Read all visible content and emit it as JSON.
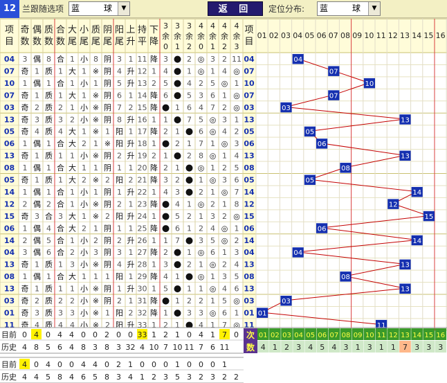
{
  "topbar": {
    "issue_count": "12",
    "follow_label": "兰跟随选项",
    "follow_select": "蓝",
    "follow_select2": "球",
    "back_button": "返 回",
    "dist_label": "定位分布:",
    "dist_select": "蓝",
    "dist_select2": "球"
  },
  "headers": [
    "项目",
    "奇数",
    "偶数",
    "质数",
    "合数",
    "大尾",
    "小尾",
    "质尾",
    "阴尾",
    "阳尾",
    "上升",
    "持平",
    "下降",
    "3余0",
    "3余1",
    "3余2",
    "4余0",
    "4余1",
    "4余2",
    "4余3"
  ],
  "dist_headers": [
    "01",
    "02",
    "03",
    "04",
    "05",
    "06",
    "07",
    "08",
    "09",
    "10",
    "11",
    "12",
    "13",
    "14",
    "15",
    "16"
  ],
  "rows": [
    [
      "04",
      "3",
      "偶",
      "8",
      "合",
      "1",
      "小",
      "8",
      "阴",
      "3",
      "1",
      "11",
      "降",
      "3",
      "●",
      "2",
      "◎",
      "3",
      "2",
      "11"
    ],
    [
      "07",
      "奇",
      "1",
      "质",
      "1",
      "大",
      "1",
      "※",
      "阴",
      "4",
      "升",
      "12",
      "1",
      "4",
      "●",
      "1",
      "◎",
      "1",
      "4",
      "◎"
    ],
    [
      "10",
      "1",
      "偶",
      "1",
      "合",
      "1",
      "小",
      "1",
      "阴",
      "5",
      "升",
      "13",
      "2",
      "5",
      "●",
      "4",
      "2",
      "5",
      "◎",
      "1"
    ],
    [
      "07",
      "奇",
      "1",
      "质",
      "1",
      "大",
      "1",
      "※",
      "阴",
      "6",
      "1",
      "14",
      "降",
      "6",
      "●",
      "5",
      "3",
      "6",
      "1",
      "◎"
    ],
    [
      "03",
      "奇",
      "2",
      "质",
      "2",
      "1",
      "小",
      "※",
      "阴",
      "7",
      "2",
      "15",
      "降",
      "●",
      "1",
      "6",
      "4",
      "7",
      "2",
      "◎"
    ],
    [
      "13",
      "奇",
      "3",
      "质",
      "3",
      "2",
      "小",
      "※",
      "阴",
      "8",
      "升",
      "16",
      "1",
      "1",
      "●",
      "7",
      "5",
      "◎",
      "3",
      "1"
    ],
    [
      "05",
      "奇",
      "4",
      "质",
      "4",
      "大",
      "1",
      "※",
      "1",
      "阳",
      "1",
      "17",
      "降",
      "2",
      "1",
      "●",
      "6",
      "◎",
      "4",
      "2"
    ],
    [
      "06",
      "1",
      "偶",
      "1",
      "合",
      "大",
      "2",
      "1",
      "※",
      "阳",
      "升",
      "18",
      "1",
      "●",
      "2",
      "1",
      "7",
      "1",
      "◎",
      "3"
    ],
    [
      "13",
      "奇",
      "1",
      "质",
      "1",
      "1",
      "小",
      "※",
      "阴",
      "2",
      "升",
      "19",
      "2",
      "1",
      "●",
      "2",
      "8",
      "◎",
      "1",
      "4"
    ],
    [
      "08",
      "1",
      "偶",
      "1",
      "合",
      "大",
      "1",
      "1",
      "阴",
      "1",
      "1",
      "20",
      "降",
      "2",
      "1",
      "●",
      "◎",
      "1",
      "2",
      "5"
    ],
    [
      "05",
      "奇",
      "1",
      "质",
      "1",
      "大",
      "2",
      "※",
      "2",
      "阳",
      "2",
      "21",
      "降",
      "3",
      "2",
      "●",
      "1",
      "◎",
      "3",
      "6"
    ],
    [
      "14",
      "1",
      "偶",
      "1",
      "合",
      "1",
      "小",
      "1",
      "阴",
      "1",
      "升",
      "22",
      "1",
      "4",
      "3",
      "●",
      "2",
      "1",
      "◎",
      "7"
    ],
    [
      "12",
      "2",
      "偶",
      "2",
      "合",
      "1",
      "小",
      "※",
      "阴",
      "2",
      "1",
      "23",
      "降",
      "●",
      "4",
      "1",
      "◎",
      "2",
      "1",
      "8"
    ],
    [
      "15",
      "奇",
      "3",
      "合",
      "3",
      "大",
      "1",
      "※",
      "2",
      "阳",
      "升",
      "24",
      "1",
      "●",
      "5",
      "2",
      "1",
      "3",
      "2",
      "◎"
    ],
    [
      "06",
      "1",
      "偶",
      "4",
      "合",
      "大",
      "2",
      "1",
      "阴",
      "1",
      "1",
      "25",
      "降",
      "●",
      "6",
      "1",
      "2",
      "4",
      "◎",
      "1"
    ],
    [
      "14",
      "2",
      "偶",
      "5",
      "合",
      "1",
      "小",
      "2",
      "阴",
      "2",
      "升",
      "26",
      "1",
      "1",
      "7",
      "●",
      "3",
      "5",
      "◎",
      "2"
    ],
    [
      "04",
      "3",
      "偶",
      "6",
      "合",
      "2",
      "小",
      "3",
      "阴",
      "3",
      "1",
      "27",
      "降",
      "2",
      "●",
      "1",
      "◎",
      "6",
      "1",
      "3"
    ],
    [
      "13",
      "奇",
      "1",
      "质",
      "1",
      "3",
      "小",
      "※",
      "阴",
      "4",
      "升",
      "28",
      "1",
      "3",
      "●",
      "2",
      "1",
      "◎",
      "2",
      "4"
    ],
    [
      "08",
      "1",
      "偶",
      "1",
      "合",
      "大",
      "1",
      "1",
      "1",
      "阳",
      "1",
      "29",
      "降",
      "4",
      "1",
      "●",
      "◎",
      "1",
      "3",
      "5"
    ],
    [
      "13",
      "奇",
      "1",
      "质",
      "1",
      "1",
      "小",
      "※",
      "阴",
      "1",
      "升",
      "30",
      "1",
      "5",
      "●",
      "1",
      "1",
      "◎",
      "4",
      "6"
    ],
    [
      "03",
      "奇",
      "2",
      "质",
      "2",
      "2",
      "小",
      "※",
      "阴",
      "2",
      "1",
      "31",
      "降",
      "●",
      "1",
      "2",
      "2",
      "1",
      "5",
      "◎"
    ],
    [
      "01",
      "奇",
      "3",
      "质",
      "3",
      "3",
      "小",
      "※",
      "1",
      "阳",
      "2",
      "32",
      "降",
      "1",
      "●",
      "3",
      "3",
      "◎",
      "6",
      "1"
    ],
    [
      "11",
      "奇",
      "4",
      "质",
      "4",
      "4",
      "小",
      "※",
      "2",
      "阳",
      "升",
      "33",
      "1",
      "2",
      "1",
      "●",
      "4",
      "1",
      "7",
      "◎"
    ]
  ],
  "dist_rows": [
    [
      "",
      "",
      "",
      "04",
      "",
      "",
      "",
      "",
      "",
      "",
      "",
      "",
      "",
      "",
      "",
      ""
    ],
    [
      "",
      "",
      "",
      "",
      "",
      "",
      "07",
      "",
      "",
      "",
      "",
      "",
      "",
      "",
      "",
      ""
    ],
    [
      "",
      "",
      "",
      "",
      "",
      "",
      "",
      "",
      "",
      "10",
      "",
      "",
      "",
      "",
      "",
      ""
    ],
    [
      "",
      "",
      "",
      "",
      "",
      "",
      "07",
      "",
      "",
      "",
      "",
      "",
      "",
      "",
      "",
      ""
    ],
    [
      "",
      "",
      "03",
      "",
      "",
      "",
      "",
      "",
      "",
      "",
      "",
      "",
      "",
      "",
      "",
      ""
    ],
    [
      "",
      "",
      "",
      "",
      "",
      "",
      "",
      "",
      "",
      "",
      "",
      "",
      "13",
      "",
      "",
      ""
    ],
    [
      "",
      "",
      "",
      "",
      "05",
      "",
      "",
      "",
      "",
      "",
      "",
      "",
      "",
      "",
      "",
      ""
    ],
    [
      "",
      "",
      "",
      "",
      "",
      "06",
      "",
      "",
      "",
      "",
      "",
      "",
      "",
      "",
      "",
      ""
    ],
    [
      "",
      "",
      "",
      "",
      "",
      "",
      "",
      "",
      "",
      "",
      "",
      "",
      "13",
      "",
      "",
      ""
    ],
    [
      "",
      "",
      "",
      "",
      "",
      "",
      "",
      "08",
      "",
      "",
      "",
      "",
      "",
      "",
      "",
      ""
    ],
    [
      "",
      "",
      "",
      "",
      "05",
      "",
      "",
      "",
      "",
      "",
      "",
      "",
      "",
      "",
      "",
      ""
    ],
    [
      "",
      "",
      "",
      "",
      "",
      "",
      "",
      "",
      "",
      "",
      "",
      "",
      "",
      "14",
      "",
      ""
    ],
    [
      "",
      "",
      "",
      "",
      "",
      "",
      "",
      "",
      "",
      "",
      "",
      "12",
      "",
      "",
      "",
      ""
    ],
    [
      "",
      "",
      "",
      "",
      "",
      "",
      "",
      "",
      "",
      "",
      "",
      "",
      "",
      "",
      "15",
      ""
    ],
    [
      "",
      "",
      "",
      "",
      "",
      "06",
      "",
      "",
      "",
      "",
      "",
      "",
      "",
      "",
      "",
      ""
    ],
    [
      "",
      "",
      "",
      "",
      "",
      "",
      "",
      "",
      "",
      "",
      "",
      "",
      "",
      "14",
      "",
      ""
    ],
    [
      "",
      "",
      "",
      "04",
      "",
      "",
      "",
      "",
      "",
      "",
      "",
      "",
      "",
      "",
      "",
      ""
    ],
    [
      "",
      "",
      "",
      "",
      "",
      "",
      "",
      "",
      "",
      "",
      "",
      "",
      "13",
      "",
      "",
      ""
    ],
    [
      "",
      "",
      "",
      "",
      "",
      "",
      "",
      "08",
      "",
      "",
      "",
      "",
      "",
      "",
      "",
      ""
    ],
    [
      "",
      "",
      "",
      "",
      "",
      "",
      "",
      "",
      "",
      "",
      "",
      "",
      "13",
      "",
      "",
      ""
    ],
    [
      "",
      "",
      "03",
      "",
      "",
      "",
      "",
      "",
      "",
      "",
      "",
      "",
      "",
      "",
      "",
      ""
    ],
    [
      "01",
      "",
      "",
      "",
      "",
      "",
      "",
      "",
      "",
      "",
      "",
      "",
      "",
      "",
      "",
      ""
    ],
    [
      "",
      "",
      "",
      "",
      "",
      "",
      "",
      "",
      "",
      "",
      "11",
      "",
      "",
      "",
      "",
      ""
    ]
  ],
  "stats1": {
    "current_label": "目前",
    "history_label": "历史",
    "current": [
      "0",
      "4",
      "0",
      "4",
      "4",
      "0",
      "0",
      "2",
      "0",
      "0",
      "33",
      "1",
      "2",
      "1",
      "0",
      "4",
      "1",
      "7",
      "0"
    ],
    "history": [
      "4",
      "8",
      "5",
      "6",
      "4",
      "8",
      "3",
      "8",
      "3",
      "32",
      "4",
      "10",
      "7",
      "10",
      "11",
      "7",
      "6",
      "11"
    ]
  },
  "next": {
    "label_a": "次",
    "label_b": "数",
    "nums": [
      "01",
      "02",
      "03",
      "04",
      "05",
      "06",
      "07",
      "08",
      "09",
      "10",
      "11",
      "12",
      "13",
      "14",
      "15",
      "16"
    ],
    "counts": [
      "4",
      "1",
      "2",
      "3",
      "4",
      "5",
      "4",
      "3",
      "1",
      "3",
      "1",
      "1",
      "7",
      "3",
      "3",
      "3"
    ]
  },
  "stats2": {
    "current_label": "目前",
    "history_label": "历史",
    "current": [
      "4",
      "0",
      "4",
      "0",
      "0",
      "4",
      "4",
      "0",
      "2",
      "1",
      "0",
      "0",
      "0",
      "1",
      "0",
      "0",
      "0",
      "1"
    ],
    "history": [
      "4",
      "4",
      "5",
      "8",
      "4",
      "6",
      "5",
      "8",
      "3",
      "4",
      "1",
      "2",
      "3",
      "5",
      "3",
      "2",
      "3",
      "2",
      "2"
    ]
  },
  "colors": {
    "blue_cell": "#1530b0",
    "red_line": "#c40000",
    "header_bg": "#fffcd9",
    "yellow": "#fff200",
    "next_bg": "#3a9a2a",
    "next_label_bg": "#5a3290",
    "peach": "#ffb88a"
  }
}
